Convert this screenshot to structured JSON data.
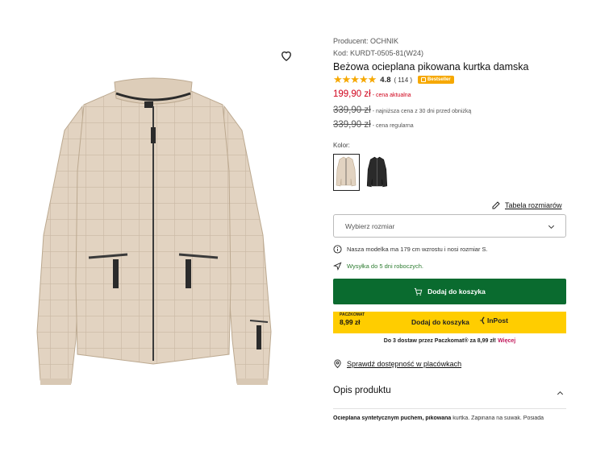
{
  "product": {
    "producer": "Producent: OCHNIK",
    "code": "Kod: KURDT-0505-81(W24)",
    "title": "Beżowa ocieplana pikowana kurtka damska",
    "rating_value": "4.8",
    "rating_count": "( 114 )",
    "rating_stars": 4.8,
    "badge": "Bestseller"
  },
  "prices": {
    "current": "199,90 zł",
    "current_label": "- cena aktualna",
    "lowest": "339,90 zł",
    "lowest_label": "- najniższa cena z 30 dni przed obniżką",
    "regular": "339,90 zł",
    "regular_label": "- cena regularna"
  },
  "colors": {
    "label": "Kolor:",
    "options": [
      "beige",
      "black"
    ],
    "accent_red": "#d0021b",
    "accent_green": "#0a6b2f",
    "inpost_yellow": "#ffcd00",
    "star_color": "#f6a800"
  },
  "size": {
    "table_link": "Tabela rozmiarów",
    "placeholder": "Wybierz rozmiar"
  },
  "notes": {
    "model": "Nasza modelka ma 179 cm wzrostu i nosi rozmiar S.",
    "shipping": "Wysyłka do 5 dni roboczych."
  },
  "cart": {
    "add_label": "Dodaj do koszyka"
  },
  "inpost": {
    "paczkomat_label": "PACZKOMAT",
    "paczkomat_price": "8,99 zł",
    "add_label": "Dodaj do koszyka",
    "logo_text": "InPost"
  },
  "delivery": {
    "text": "Do 3 dostaw przez Paczkomat® za 8,99 zł!",
    "more": "Więcej"
  },
  "stores": {
    "label": "Sprawdź dostępność w placówkach"
  },
  "description": {
    "heading": "Opis produktu",
    "bold1": "Ocieplana syntetycznym puchem, pikowana",
    "rest": " kurtka. Zapinana na suwak. Posiada"
  },
  "icons": {
    "wishlist": "heart-icon",
    "ruler": "pencil-ruler-icon",
    "info": "info-icon",
    "send": "send-icon",
    "cart": "cart-icon",
    "location": "location-pin-icon",
    "chevron_down": "chevron-down-icon",
    "chevron_up": "chevron-up-icon"
  }
}
